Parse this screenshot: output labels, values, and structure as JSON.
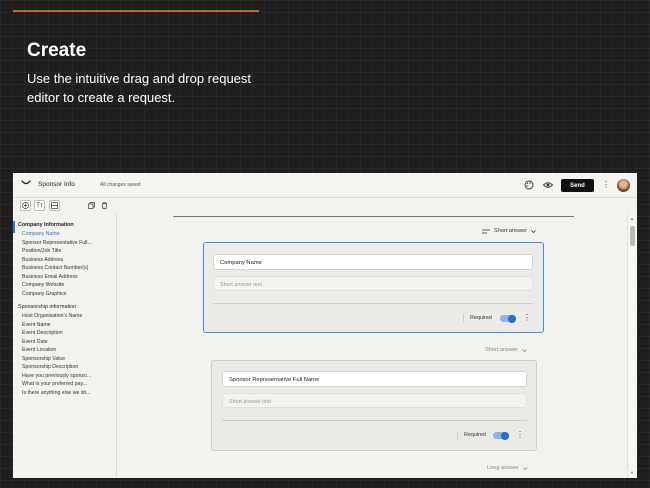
{
  "hero": {
    "title": "Create",
    "description": "Use the intuitive drag and drop request editor to create a request."
  },
  "app": {
    "header": {
      "title": "Sponsor Info",
      "save_status": "All changes saved",
      "send_label": "Send"
    },
    "toolbar": {
      "tools": [
        "add-icon",
        "text-format-icon",
        "section-icon",
        "copy-icon",
        "delete-icon"
      ],
      "text_tool_label": "Tт"
    },
    "sidebar": {
      "sections": [
        {
          "title": "Company Information",
          "items": [
            "Company Name",
            "Sponsor Representative Full...",
            "Position/Job Title",
            "Business Address",
            "Business Contact Number(s)",
            "Business Email Address",
            "Company Website",
            "Company Graphics"
          ]
        },
        {
          "title": "Sponsorship information",
          "items": [
            "Host Organisation's Name",
            "Event Name",
            "Event Description",
            "Event Date",
            "Event Location",
            "Sponsorship Value",
            "Sponsorship Description",
            "Have you previously sponso...",
            "What is your preferred pay...",
            "Is there anything else we sh..."
          ]
        }
      ]
    },
    "editor": {
      "questions": [
        {
          "type": "Short answer",
          "title": "Company Name",
          "placeholder": "Short answer text",
          "required_label": "Required",
          "required": true
        },
        {
          "type": "Short answer",
          "title": "Sponsor Representative Full Name",
          "placeholder": "Short answer text",
          "required_label": "Required",
          "required": true
        },
        {
          "type": "Long answer"
        }
      ]
    },
    "colors": {
      "accent": "#c8642a",
      "selection": "#3a8ee6",
      "toggle_on": "#1f6fd6"
    }
  }
}
